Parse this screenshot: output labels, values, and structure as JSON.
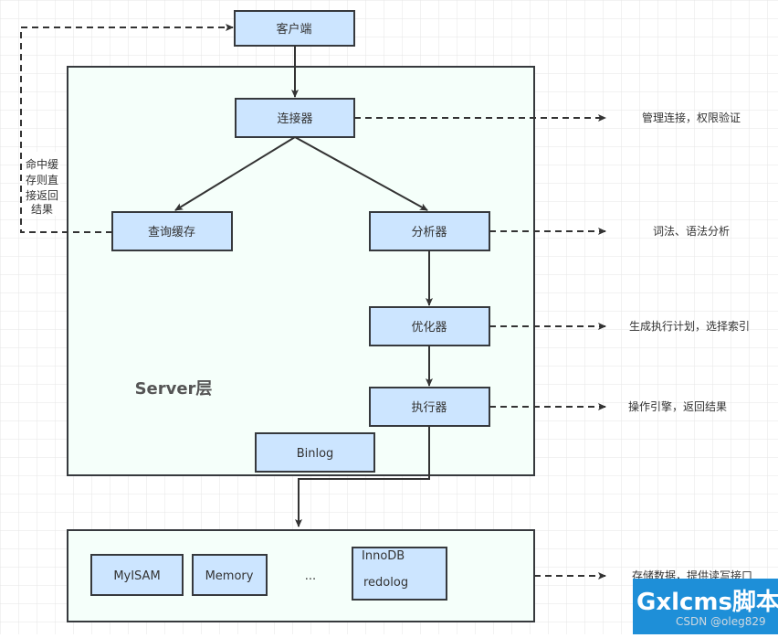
{
  "colors": {
    "box_fill": "#cce5ff",
    "container_fill": "#f5fffa",
    "stroke": "#36393d",
    "watermark_bg": "#1e8fd8"
  },
  "nodes": {
    "client": "客户端",
    "connector": "连接器",
    "query_cache": "查询缓存",
    "analyzer": "分析器",
    "optimizer": "优化器",
    "executor": "执行器",
    "binlog": "Binlog",
    "server_layer": "Server层",
    "myisam": "MyISAM",
    "memory": "Memory",
    "ellipsis": "...",
    "innodb": "InnoDB",
    "redolog": "redolog"
  },
  "notes": {
    "connector": "管理连接，权限验证",
    "analyzer": "词法、语法分析",
    "optimizer": "生成执行计划，选择索引",
    "executor": "操作引擎，返回结果",
    "storage": "存储数据，提供读写接口",
    "cache_hit": [
      "命中缓",
      "存则直",
      "接返回",
      "结果"
    ]
  },
  "watermark": {
    "brand": "Gxlcms脚本",
    "credit": "CSDN @oleg829"
  }
}
